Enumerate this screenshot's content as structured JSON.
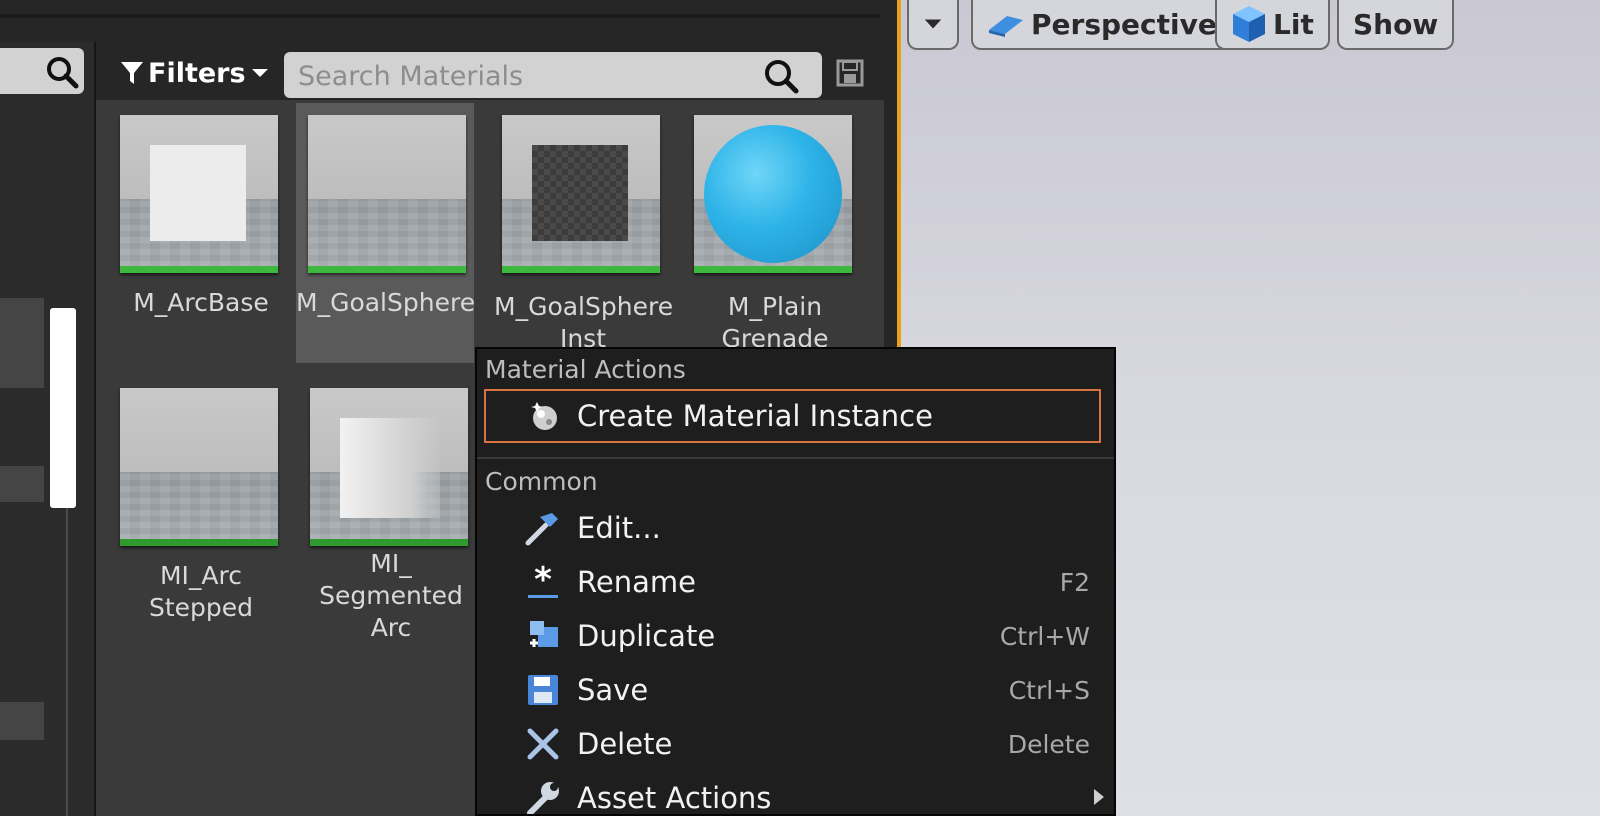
{
  "toolbar": {
    "filters_label": "Filters",
    "search_placeholder": "Search Materials"
  },
  "assets": [
    {
      "label": "M_ArcBase",
      "thumb": "white-square"
    },
    {
      "label": "M_GoalSphere",
      "thumb": "plain",
      "selected": true
    },
    {
      "label": "M_GoalSphere\nInst",
      "thumb": "dark-checker-square"
    },
    {
      "label": "M_Plain\nGrenade",
      "thumb": "blue-sphere"
    },
    {
      "label": "MI_Arc\nStepped",
      "thumb": "plain"
    },
    {
      "label": "MI_\nSegmented\nArc",
      "thumb": "gradient-square"
    }
  ],
  "viewport": {
    "perspective_label": "Perspective",
    "lit_label": "Lit",
    "show_label": "Show",
    "accent": "#e7a21a"
  },
  "menu": {
    "section_material": "Material Actions",
    "create_instance": "Create Material Instance",
    "section_common": "Common",
    "items": [
      {
        "label": "Edit...",
        "shortcut": "",
        "icon": "hammer-icon"
      },
      {
        "label": "Rename",
        "shortcut": "F2",
        "icon": "rename-star-icon"
      },
      {
        "label": "Duplicate",
        "shortcut": "Ctrl+W",
        "icon": "duplicate-icon"
      },
      {
        "label": "Save",
        "shortcut": "Ctrl+S",
        "icon": "save-icon"
      },
      {
        "label": "Delete",
        "shortcut": "Delete",
        "icon": "delete-x-icon"
      },
      {
        "label": "Asset Actions",
        "shortcut": "",
        "icon": "wrench-icon"
      }
    ]
  },
  "colors": {
    "highlight_border": "#d9733f",
    "asset_bar": "#3cb83c",
    "sphere": "#2db3e8"
  }
}
